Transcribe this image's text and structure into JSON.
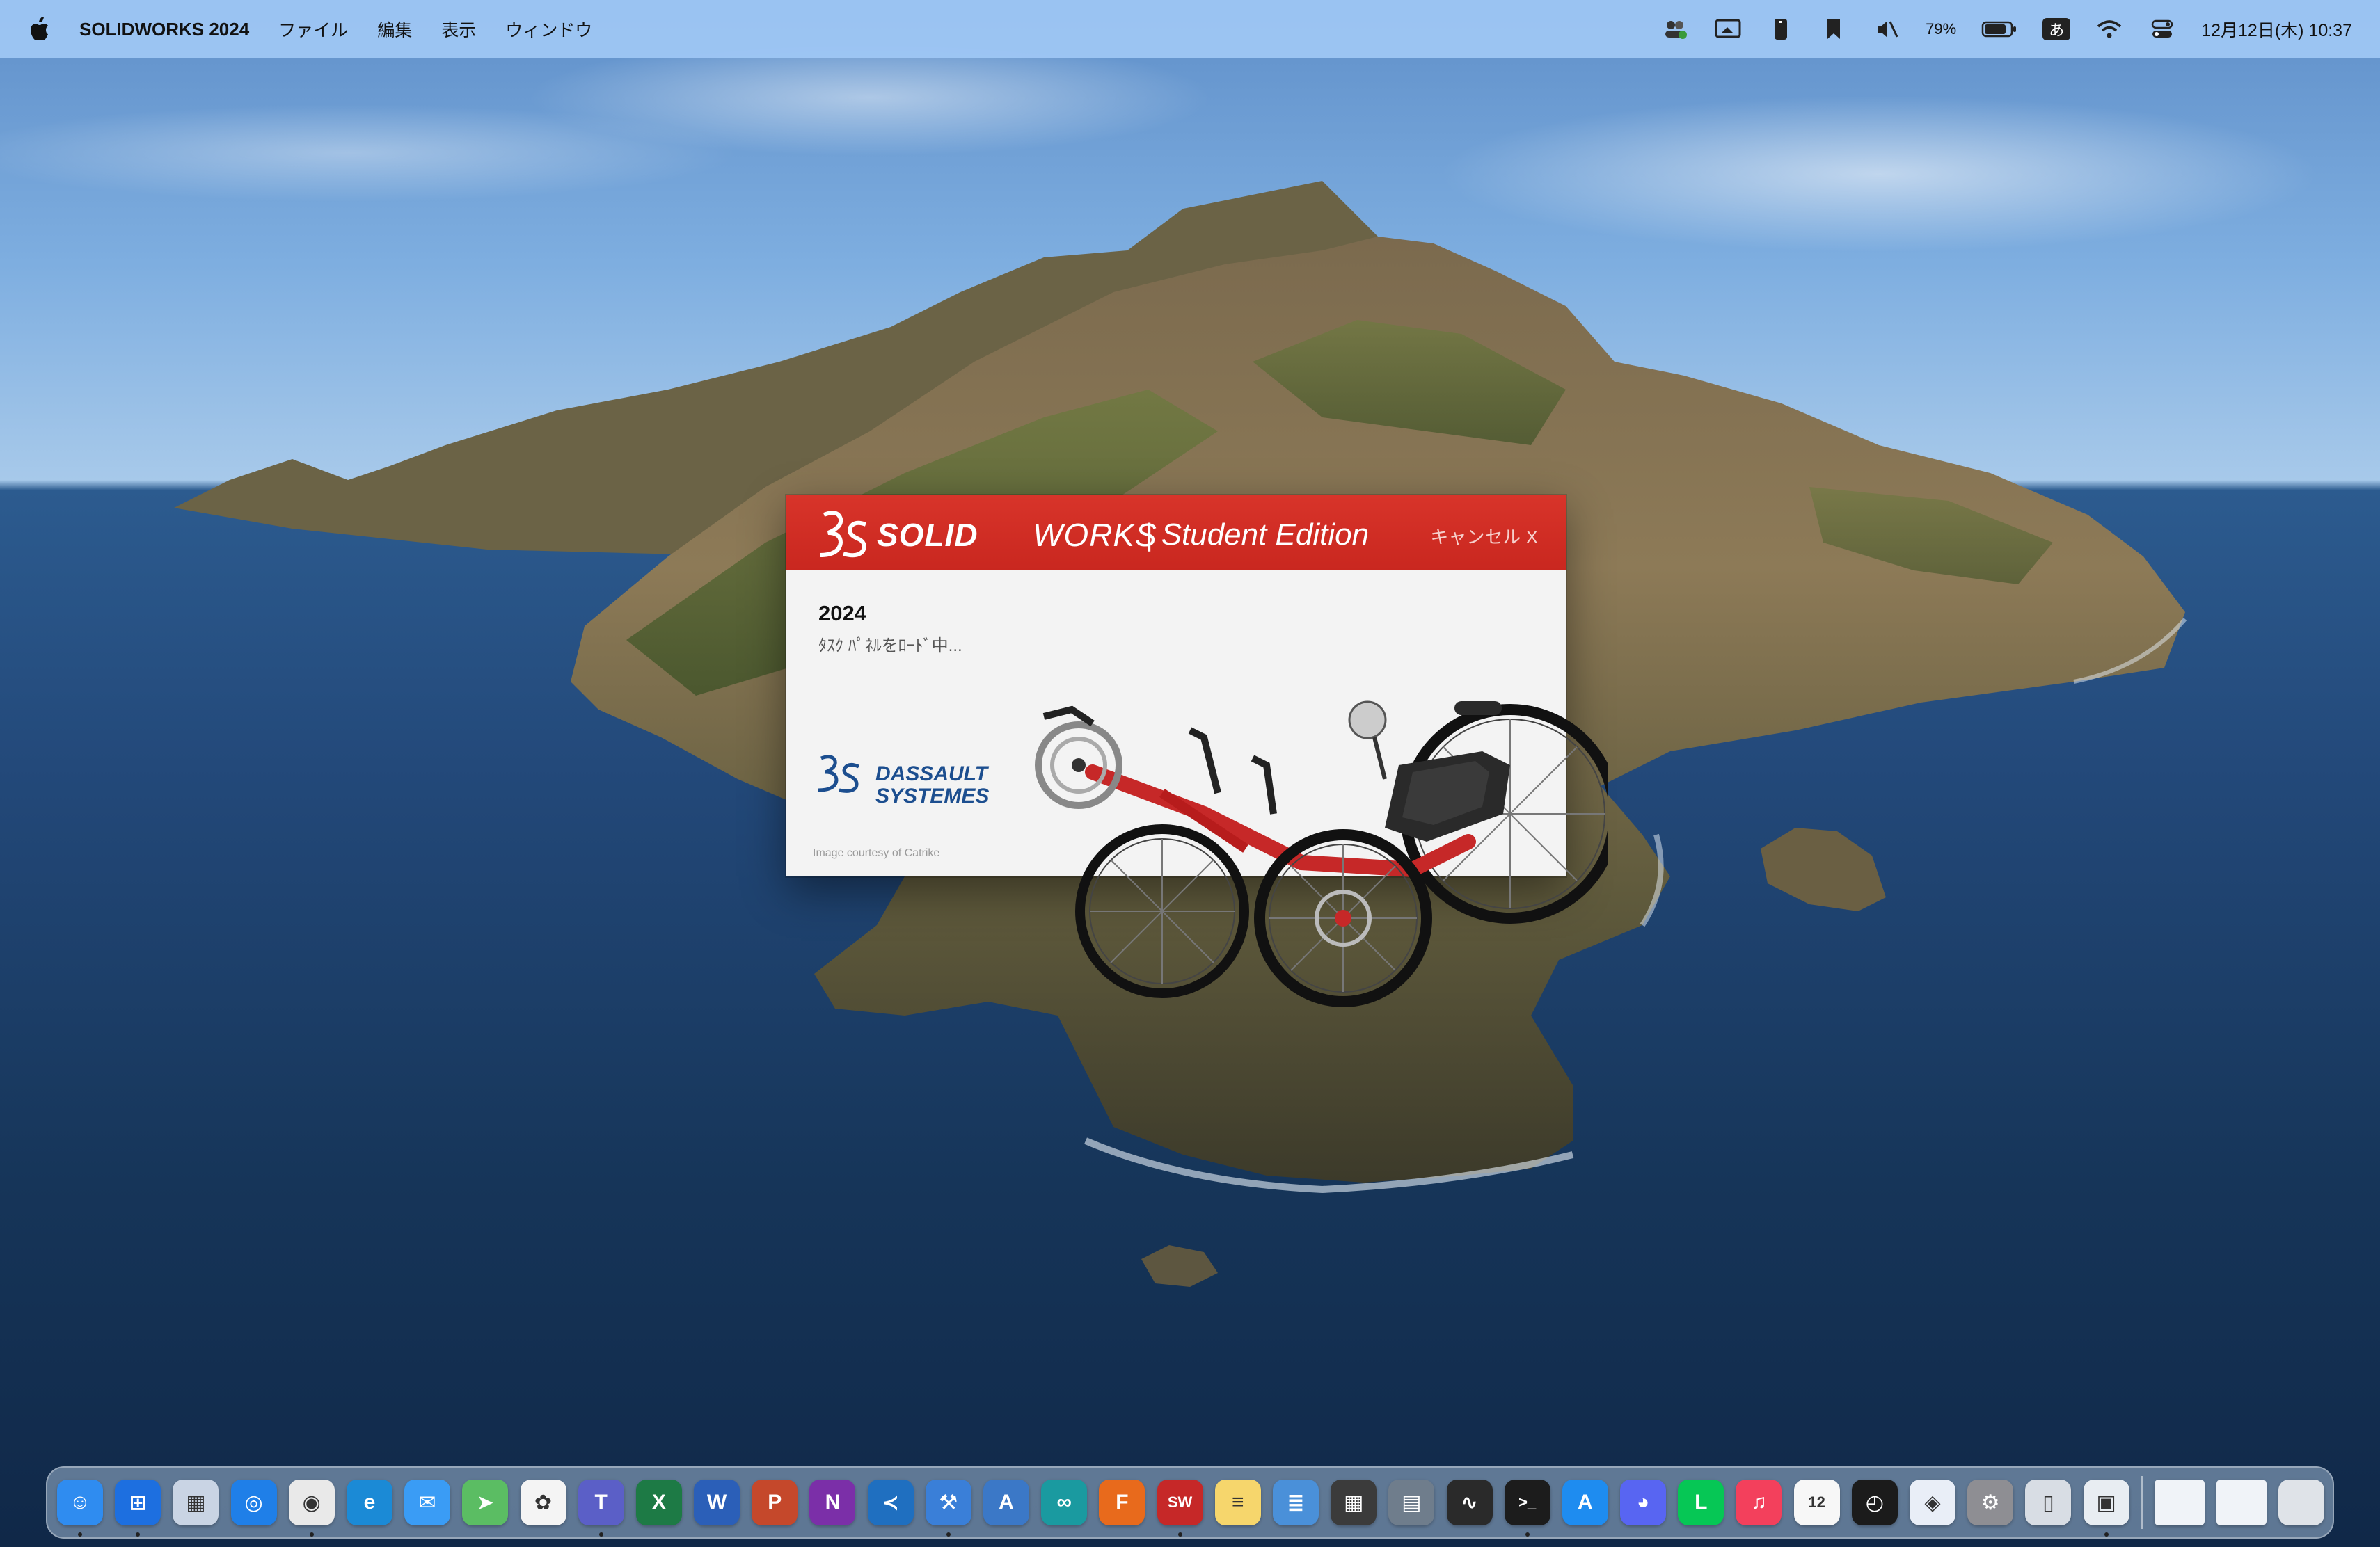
{
  "menubar": {
    "app_name": "SOLIDWORKS 2024",
    "menus": [
      "ファイル",
      "編集",
      "表示",
      "ウィンドウ"
    ],
    "battery": "79%",
    "ime": "あ",
    "clock": "12月12日(木) 10:37"
  },
  "splash": {
    "brand_strong": "SOLID",
    "brand_light": "WORKS",
    "edition": "| Student Edition",
    "cancel": "キャンセル X",
    "version": "2024",
    "status": "ﾀｽｸ ﾊﾟﾈﾙをﾛｰﾄﾞ中...",
    "company_line1": "DASSAULT",
    "company_line2": "SYSTEMES",
    "credit": "Image courtesy of Catrike"
  },
  "dock": {
    "apps": [
      {
        "name": "finder",
        "color": "#2f8cf0",
        "glyph": "☺",
        "running": true
      },
      {
        "name": "windows-app",
        "color": "#1d6fe0",
        "glyph": "⊞",
        "running": true
      },
      {
        "name": "launchpad",
        "color": "#c9d4e4",
        "glyph": "▦",
        "running": false
      },
      {
        "name": "safari",
        "color": "#1f7fe8",
        "glyph": "◎",
        "running": false
      },
      {
        "name": "chrome",
        "color": "#e9e9e9",
        "glyph": "◉",
        "running": true
      },
      {
        "name": "edge",
        "color": "#1b8ad6",
        "glyph": "e",
        "running": false
      },
      {
        "name": "mail",
        "color": "#3a9cf5",
        "glyph": "✉",
        "running": false
      },
      {
        "name": "maps",
        "color": "#5bbd63",
        "glyph": "➤",
        "running": false
      },
      {
        "name": "photos",
        "color": "#f4f4f4",
        "glyph": "✿",
        "running": false
      },
      {
        "name": "teams",
        "color": "#5b5fc7",
        "glyph": "T",
        "running": true
      },
      {
        "name": "excel",
        "color": "#1d7a45",
        "glyph": "X",
        "running": false
      },
      {
        "name": "word",
        "color": "#2b5fb8",
        "glyph": "W",
        "running": false
      },
      {
        "name": "powerpoint",
        "color": "#c5482b",
        "glyph": "P",
        "running": false
      },
      {
        "name": "onenote",
        "color": "#7b2fa8",
        "glyph": "N",
        "running": false
      },
      {
        "name": "vscode",
        "color": "#1f6fc0",
        "glyph": "≺",
        "running": false
      },
      {
        "name": "xcode",
        "color": "#3a7fd8",
        "glyph": "⚒",
        "running": true
      },
      {
        "name": "instruments",
        "color": "#3b78c7",
        "glyph": "A",
        "running": false
      },
      {
        "name": "arduino",
        "color": "#1a9aa0",
        "glyph": "∞",
        "running": false
      },
      {
        "name": "fusion",
        "color": "#e86a1c",
        "glyph": "F",
        "running": false
      },
      {
        "name": "solidworks",
        "color": "#c62828",
        "glyph": "SW",
        "running": true
      },
      {
        "name": "notes",
        "color": "#f6d66c",
        "glyph": "≡",
        "running": false
      },
      {
        "name": "textedit",
        "color": "#4a90d9",
        "glyph": "≣",
        "running": false
      },
      {
        "name": "calculator",
        "color": "#3b3b3b",
        "glyph": "▦",
        "running": false
      },
      {
        "name": "system-info",
        "color": "#6f7d8c",
        "glyph": "▤",
        "running": false
      },
      {
        "name": "activity-monitor",
        "color": "#2a2a2a",
        "glyph": "∿",
        "running": false
      },
      {
        "name": "terminal",
        "color": "#1c1c1c",
        "glyph": ">_",
        "running": true
      },
      {
        "name": "app-store",
        "color": "#1e8cf0",
        "glyph": "A",
        "running": false
      },
      {
        "name": "discord",
        "color": "#5865f2",
        "glyph": "◕",
        "running": false
      },
      {
        "name": "line",
        "color": "#06c755",
        "glyph": "L",
        "running": false
      },
      {
        "name": "music",
        "color": "#f3405c",
        "glyph": "♫",
        "running": false
      },
      {
        "name": "calendar",
        "color": "#f7f7f7",
        "glyph": "12",
        "running": false
      },
      {
        "name": "clock",
        "color": "#1b1b1b",
        "glyph": "◴",
        "running": false
      },
      {
        "name": "keynote",
        "color": "#e9eef7",
        "glyph": "◈",
        "running": false
      },
      {
        "name": "system-settings",
        "color": "#8e8e93",
        "glyph": "⚙",
        "running": false
      },
      {
        "name": "iphone-mirroring",
        "color": "#d8dde4",
        "glyph": "▯",
        "running": false
      },
      {
        "name": "preview",
        "color": "#e8edf2",
        "glyph": "▣",
        "running": true
      }
    ],
    "minimized": [
      {
        "name": "minimized-window-1",
        "color": "#f0f3f8"
      },
      {
        "name": "minimized-window-2",
        "color": "#f0f3f8"
      }
    ],
    "trash": {
      "name": "trash",
      "color": "#dfe3e8"
    }
  }
}
